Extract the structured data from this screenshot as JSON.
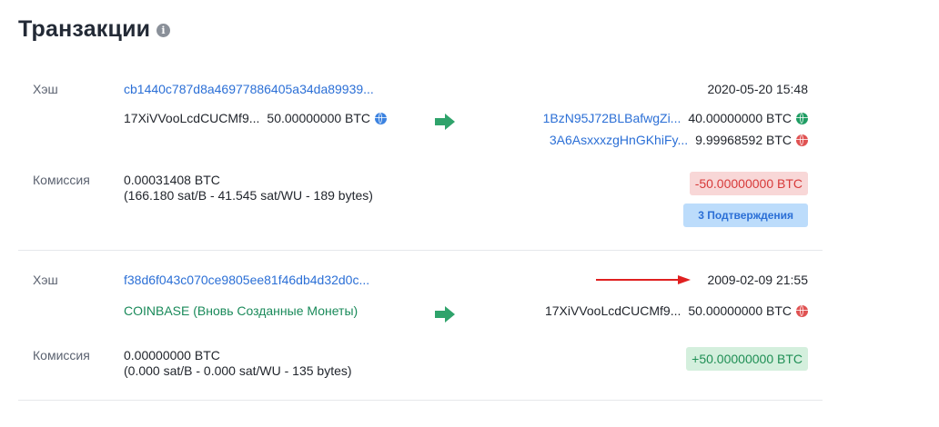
{
  "header": {
    "title": "Транзакции",
    "info_icon": "info-circle-icon"
  },
  "colors": {
    "link": "#2b6fd6",
    "negative": "#d73a3a",
    "positive": "#1f8f55",
    "confirm_bg": "#bcdcfb",
    "arrow": "#2fa36b",
    "annotation": "#e02020"
  },
  "transactions": [
    {
      "hash_label": "Хэш",
      "hash": "cb1440c787d8a46977886405a34da89939...",
      "date": "2020-05-20 15:48",
      "inputs": [
        {
          "address": "17XiVVooLcdCUCMf9...",
          "amount": "50.00000000 BTC",
          "icon": "globe-blue-icon"
        }
      ],
      "outputs": [
        {
          "address": "1BzN95J72BLBafwgZi...",
          "amount": "40.00000000 BTC",
          "icon": "globe-green-icon"
        },
        {
          "address": "3A6AsxxxzgHnGKhiFy...",
          "amount": "9.99968592 BTC",
          "icon": "globe-red-icon"
        }
      ],
      "fee_label": "Комиссия",
      "fee": "0.00031408 BTC",
      "fee_detail": "(166.180 sat/B - 41.545 sat/WU - 189 bytes)",
      "total": "-50.00000000 BTC",
      "confirmations": "3 Подтверждения"
    },
    {
      "hash_label": "Хэш",
      "hash": "f38d6f043c070ce9805ee81f46db4d32d0c...",
      "date": "2009-02-09 21:55",
      "inputs": [
        {
          "address": "COINBASE (Вновь Созданные Монеты)"
        }
      ],
      "outputs": [
        {
          "address": "17XiVVooLcdCUCMf9...",
          "amount": "50.00000000 BTC",
          "icon": "globe-red-icon"
        }
      ],
      "fee_label": "Комиссия",
      "fee": "0.00000000 BTC",
      "fee_detail": "(0.000 sat/B - 0.000 sat/WU - 135 bytes)",
      "total": "+50.00000000 BTC"
    }
  ]
}
